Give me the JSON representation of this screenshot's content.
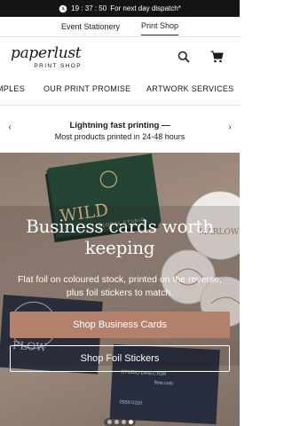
{
  "announcement": {
    "time": "19 : 37 : 50",
    "text": "For next day dispatch*",
    "icon": "clock-icon"
  },
  "site_switch": {
    "items": [
      "Event Stationery",
      "Print Shop"
    ],
    "active": "Print Shop"
  },
  "brand": {
    "wordmark": "paperlust",
    "sub": "PRINT SHOP"
  },
  "header_icons": [
    "search-icon",
    "cart-icon"
  ],
  "nav": {
    "items": [
      "MPLES",
      "OUR PRINT PROMISE",
      "ARTWORK SERVICES"
    ]
  },
  "promo": {
    "title": "Lightning fast printing —",
    "body": "Most products printed in 24-48 hours",
    "prev": "‹",
    "next": "›"
  },
  "hero": {
    "title_line1": "Business cards worth",
    "title_line2": "keeping",
    "subtitle_line1": "Flat foil on coloured stock, printed on the reverse,",
    "subtitle_line2": "plus foil stickers to match.",
    "primary_cta": "Shop Business Cards",
    "secondary_cta": "Shop Foil Stickers",
    "card_text_wild": "WILD",
    "card_text_floral": "FLORAL STUDIO",
    "card_text_flow": "FLOW",
    "card_text_director": "STUDIO DIRECTOR",
    "card_text_flow_site": "flow.com",
    "card_text_phone": "0550 0110",
    "sticker_text": "MARLOWE"
  },
  "carousel": {
    "count": 4,
    "active_index": 3
  },
  "colors": {
    "announcement_bg": "#141414",
    "cta_primary": "#b3806b",
    "hero_bg": "#9a887b"
  }
}
